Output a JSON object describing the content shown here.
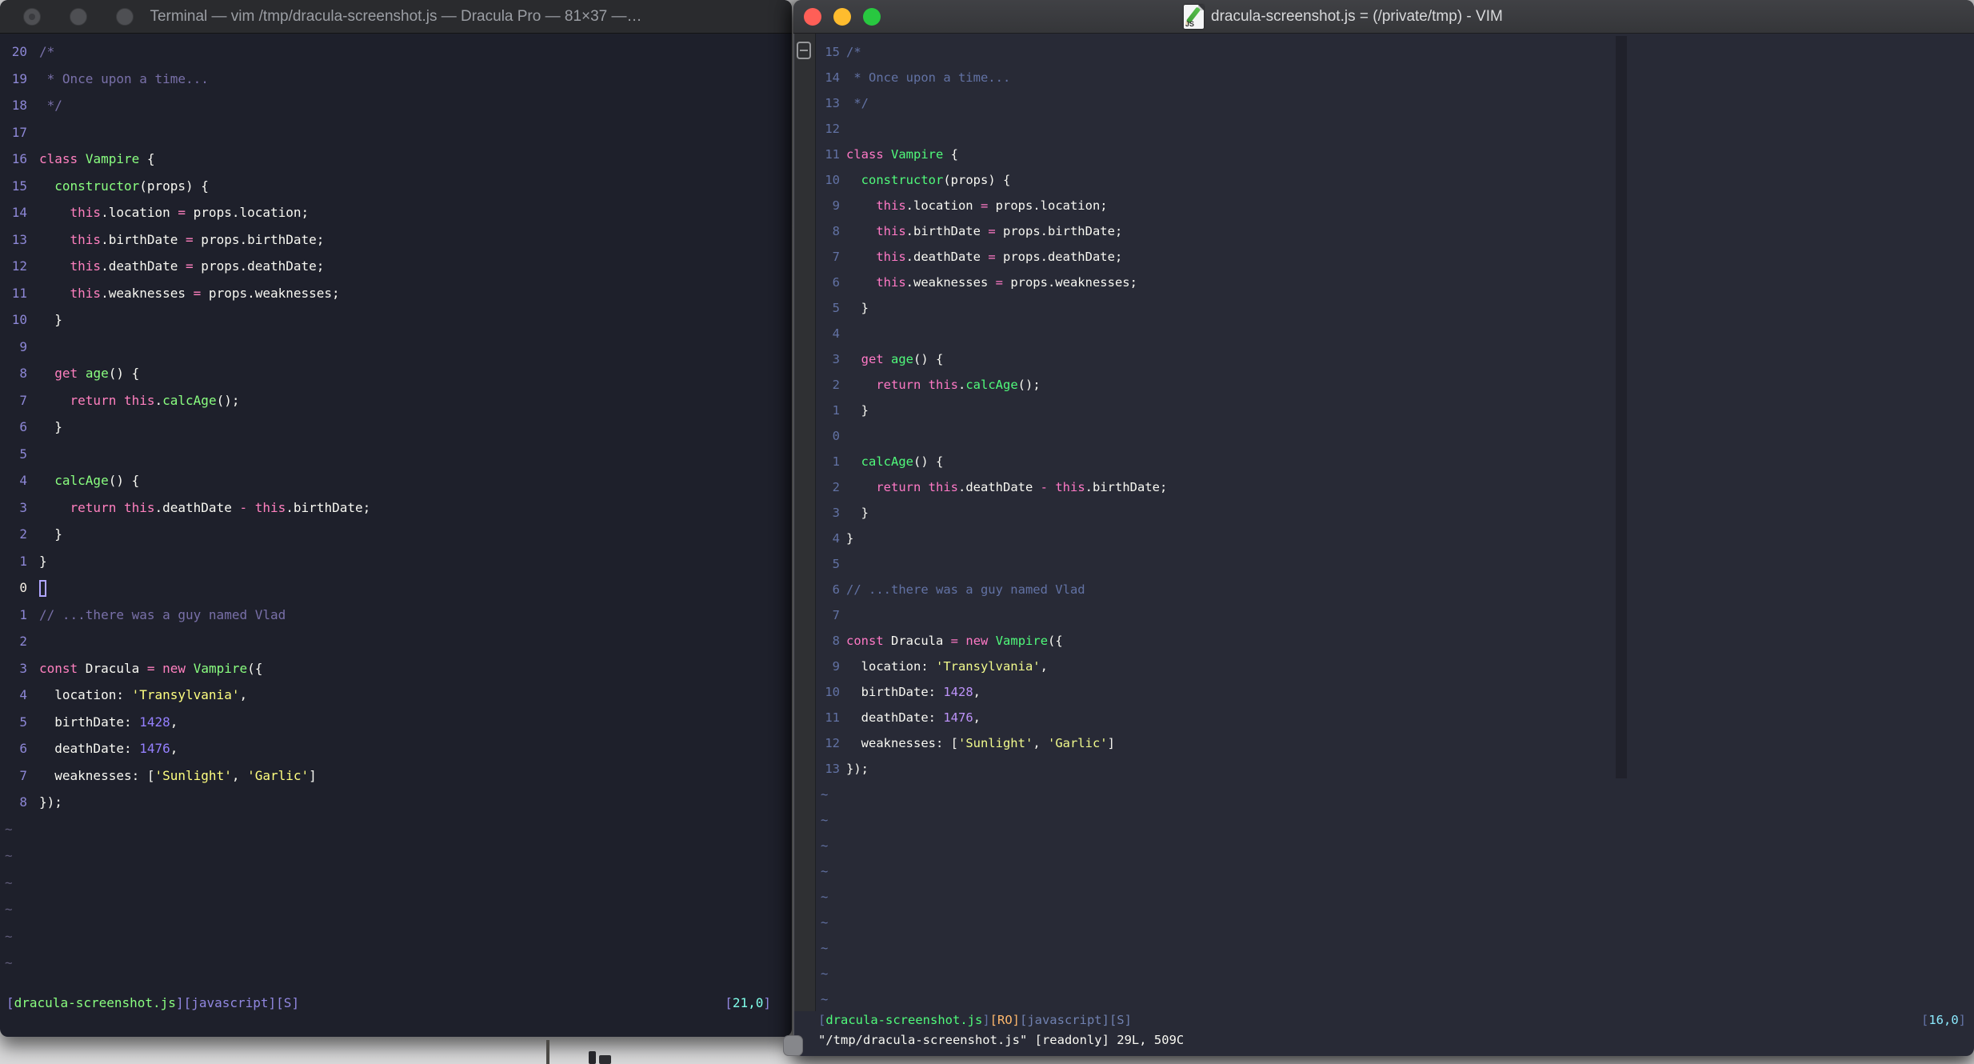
{
  "left_window": {
    "title": "Terminal — vim /tmp/dracula-screenshot.js — Dracula Pro — 81×37 —…",
    "traffic_lights": {
      "close": "#4E4F53",
      "minimize": "#4E4F53",
      "zoom": "#4E4F53"
    },
    "palette": {
      "c": "#7970A9",
      "p": "#FF80BF",
      "g": "#8AFF80",
      "w": "#F8F8F2",
      "y": "#FFFF80",
      "n": "#9580FF",
      "ln": "#8D87D6",
      "ln_cur": "#F5EFE4",
      "tilde": "#5E5A78",
      "bg": "#1E202B"
    },
    "lines": [
      {
        "num": "20",
        "segs": [
          [
            "c",
            "/*"
          ]
        ]
      },
      {
        "num": "19",
        "segs": [
          [
            "c",
            " * Once upon a time..."
          ]
        ]
      },
      {
        "num": "18",
        "segs": [
          [
            "c",
            " */"
          ]
        ]
      },
      {
        "num": "17",
        "segs": []
      },
      {
        "num": "16",
        "segs": [
          [
            "p",
            "class"
          ],
          [
            "w",
            " "
          ],
          [
            "g",
            "Vampire"
          ],
          [
            "w",
            " {"
          ]
        ]
      },
      {
        "num": "15",
        "segs": [
          [
            "w",
            "  "
          ],
          [
            "g",
            "constructor"
          ],
          [
            "w",
            "(props) {"
          ]
        ]
      },
      {
        "num": "14",
        "segs": [
          [
            "w",
            "    "
          ],
          [
            "p",
            "this"
          ],
          [
            "w",
            ".location "
          ],
          [
            "p",
            "="
          ],
          [
            "w",
            " props.location;"
          ]
        ]
      },
      {
        "num": "13",
        "segs": [
          [
            "w",
            "    "
          ],
          [
            "p",
            "this"
          ],
          [
            "w",
            ".birthDate "
          ],
          [
            "p",
            "="
          ],
          [
            "w",
            " props.birthDate;"
          ]
        ]
      },
      {
        "num": "12",
        "segs": [
          [
            "w",
            "    "
          ],
          [
            "p",
            "this"
          ],
          [
            "w",
            ".deathDate "
          ],
          [
            "p",
            "="
          ],
          [
            "w",
            " props.deathDate;"
          ]
        ]
      },
      {
        "num": "11",
        "segs": [
          [
            "w",
            "    "
          ],
          [
            "p",
            "this"
          ],
          [
            "w",
            ".weaknesses "
          ],
          [
            "p",
            "="
          ],
          [
            "w",
            " props.weaknesses;"
          ]
        ]
      },
      {
        "num": "10",
        "segs": [
          [
            "w",
            "  }"
          ]
        ]
      },
      {
        "num": "9",
        "segs": []
      },
      {
        "num": "8",
        "segs": [
          [
            "w",
            "  "
          ],
          [
            "p",
            "get"
          ],
          [
            "w",
            " "
          ],
          [
            "g",
            "age"
          ],
          [
            "w",
            "() {"
          ]
        ]
      },
      {
        "num": "7",
        "segs": [
          [
            "w",
            "    "
          ],
          [
            "p",
            "return"
          ],
          [
            "w",
            " "
          ],
          [
            "p",
            "this"
          ],
          [
            "w",
            "."
          ],
          [
            "g",
            "calcAge"
          ],
          [
            "w",
            "();"
          ]
        ]
      },
      {
        "num": "6",
        "segs": [
          [
            "w",
            "  }"
          ]
        ]
      },
      {
        "num": "5",
        "segs": []
      },
      {
        "num": "4",
        "segs": [
          [
            "w",
            "  "
          ],
          [
            "g",
            "calcAge"
          ],
          [
            "w",
            "() {"
          ]
        ]
      },
      {
        "num": "3",
        "segs": [
          [
            "w",
            "    "
          ],
          [
            "p",
            "return"
          ],
          [
            "w",
            " "
          ],
          [
            "p",
            "this"
          ],
          [
            "w",
            ".deathDate "
          ],
          [
            "p",
            "-"
          ],
          [
            "w",
            " "
          ],
          [
            "p",
            "this"
          ],
          [
            "w",
            ".birthDate;"
          ]
        ]
      },
      {
        "num": "2",
        "segs": [
          [
            "w",
            "  }"
          ]
        ]
      },
      {
        "num": "1",
        "segs": [
          [
            "w",
            "}"
          ]
        ]
      },
      {
        "num": "0",
        "cursor": true,
        "segs": []
      },
      {
        "num": "1",
        "segs": [
          [
            "c",
            "// ...there was a guy named Vlad"
          ]
        ]
      },
      {
        "num": "2",
        "segs": []
      },
      {
        "num": "3",
        "segs": [
          [
            "p",
            "const"
          ],
          [
            "w",
            " Dracula "
          ],
          [
            "p",
            "="
          ],
          [
            "w",
            " "
          ],
          [
            "p",
            "new"
          ],
          [
            "w",
            " "
          ],
          [
            "g",
            "Vampire"
          ],
          [
            "w",
            "({"
          ]
        ]
      },
      {
        "num": "4",
        "segs": [
          [
            "w",
            "  location: "
          ],
          [
            "y",
            "'Transylvania'"
          ],
          [
            "w",
            ","
          ]
        ]
      },
      {
        "num": "5",
        "segs": [
          [
            "w",
            "  birthDate: "
          ],
          [
            "n",
            "1428"
          ],
          [
            "w",
            ","
          ]
        ]
      },
      {
        "num": "6",
        "segs": [
          [
            "w",
            "  deathDate: "
          ],
          [
            "n",
            "1476"
          ],
          [
            "w",
            ","
          ]
        ]
      },
      {
        "num": "7",
        "segs": [
          [
            "w",
            "  weaknesses: ["
          ],
          [
            "y",
            "'Sunlight'"
          ],
          [
            "w",
            ", "
          ],
          [
            "y",
            "'Garlic'"
          ],
          [
            "w",
            "]"
          ]
        ]
      },
      {
        "num": "8",
        "segs": [
          [
            "w",
            "});"
          ]
        ]
      }
    ],
    "tilde_count": 6,
    "status_segments": [
      [
        "[",
        "#9187E0"
      ],
      [
        "dracula-screenshot.js",
        "#8AFF80"
      ],
      [
        "]",
        "#9187E0"
      ],
      [
        "[javascript]",
        "#9187E0"
      ],
      [
        "[S]",
        "#9187E0"
      ]
    ],
    "ruler_segments": [
      [
        "[",
        "#9187E0"
      ],
      [
        "21,0",
        "#80FFEA"
      ],
      [
        "]",
        "#9187E0"
      ]
    ]
  },
  "right_window": {
    "title": "dracula-screenshot.js = (/private/tmp) - VIM",
    "doc_icon_label": "JS",
    "traffic_lights": {
      "close": "#FF5F57",
      "minimize": "#FEBC2E",
      "zoom": "#28C840"
    },
    "palette": {
      "c": "#6272A4",
      "p": "#FF79C6",
      "g": "#50FA7B",
      "w": "#F8F8F2",
      "y": "#F1FA8C",
      "n": "#BD93F9",
      "ln": "#6272A4",
      "ln_cur": "#6272A4",
      "tilde": "#6272A4",
      "bg": "#282A36"
    },
    "lines": [
      {
        "num": "15",
        "segs": [
          [
            "c",
            "/*"
          ]
        ]
      },
      {
        "num": "14",
        "segs": [
          [
            "c",
            " * Once upon a time..."
          ]
        ]
      },
      {
        "num": "13",
        "segs": [
          [
            "c",
            " */"
          ]
        ]
      },
      {
        "num": "12",
        "segs": []
      },
      {
        "num": "11",
        "segs": [
          [
            "p",
            "class"
          ],
          [
            "w",
            " "
          ],
          [
            "g",
            "Vampire"
          ],
          [
            "w",
            " {"
          ]
        ]
      },
      {
        "num": "10",
        "segs": [
          [
            "w",
            "  "
          ],
          [
            "g",
            "constructor"
          ],
          [
            "w",
            "(props) {"
          ]
        ]
      },
      {
        "num": "9",
        "segs": [
          [
            "w",
            "    "
          ],
          [
            "p",
            "this"
          ],
          [
            "w",
            ".location "
          ],
          [
            "p",
            "="
          ],
          [
            "w",
            " props.location;"
          ]
        ]
      },
      {
        "num": "8",
        "segs": [
          [
            "w",
            "    "
          ],
          [
            "p",
            "this"
          ],
          [
            "w",
            ".birthDate "
          ],
          [
            "p",
            "="
          ],
          [
            "w",
            " props.birthDate;"
          ]
        ]
      },
      {
        "num": "7",
        "segs": [
          [
            "w",
            "    "
          ],
          [
            "p",
            "this"
          ],
          [
            "w",
            ".deathDate "
          ],
          [
            "p",
            "="
          ],
          [
            "w",
            " props.deathDate;"
          ]
        ]
      },
      {
        "num": "6",
        "segs": [
          [
            "w",
            "    "
          ],
          [
            "p",
            "this"
          ],
          [
            "w",
            ".weaknesses "
          ],
          [
            "p",
            "="
          ],
          [
            "w",
            " props.weaknesses;"
          ]
        ]
      },
      {
        "num": "5",
        "segs": [
          [
            "w",
            "  }"
          ]
        ]
      },
      {
        "num": "4",
        "segs": []
      },
      {
        "num": "3",
        "segs": [
          [
            "w",
            "  "
          ],
          [
            "p",
            "get"
          ],
          [
            "w",
            " "
          ],
          [
            "g",
            "age"
          ],
          [
            "w",
            "() {"
          ]
        ]
      },
      {
        "num": "2",
        "segs": [
          [
            "w",
            "    "
          ],
          [
            "p",
            "return"
          ],
          [
            "w",
            " "
          ],
          [
            "p",
            "this"
          ],
          [
            "w",
            "."
          ],
          [
            "g",
            "calcAge"
          ],
          [
            "w",
            "();"
          ]
        ]
      },
      {
        "num": "1",
        "segs": [
          [
            "w",
            "  }"
          ]
        ]
      },
      {
        "num": "0",
        "segs": []
      },
      {
        "num": "1",
        "segs": [
          [
            "w",
            "  "
          ],
          [
            "g",
            "calcAge"
          ],
          [
            "w",
            "() {"
          ]
        ]
      },
      {
        "num": "2",
        "segs": [
          [
            "w",
            "    "
          ],
          [
            "p",
            "return"
          ],
          [
            "w",
            " "
          ],
          [
            "p",
            "this"
          ],
          [
            "w",
            ".deathDate "
          ],
          [
            "p",
            "-"
          ],
          [
            "w",
            " "
          ],
          [
            "p",
            "this"
          ],
          [
            "w",
            ".birthDate;"
          ]
        ]
      },
      {
        "num": "3",
        "segs": [
          [
            "w",
            "  }"
          ]
        ]
      },
      {
        "num": "4",
        "segs": [
          [
            "w",
            "}"
          ]
        ]
      },
      {
        "num": "5",
        "segs": []
      },
      {
        "num": "6",
        "segs": [
          [
            "c",
            "// ...there was a guy named Vlad"
          ]
        ]
      },
      {
        "num": "7",
        "segs": []
      },
      {
        "num": "8",
        "segs": [
          [
            "p",
            "const"
          ],
          [
            "w",
            " Dracula "
          ],
          [
            "p",
            "="
          ],
          [
            "w",
            " "
          ],
          [
            "p",
            "new"
          ],
          [
            "w",
            " "
          ],
          [
            "g",
            "Vampire"
          ],
          [
            "w",
            "({"
          ]
        ]
      },
      {
        "num": "9",
        "segs": [
          [
            "w",
            "  location: "
          ],
          [
            "y",
            "'Transylvania'"
          ],
          [
            "w",
            ","
          ]
        ]
      },
      {
        "num": "10",
        "segs": [
          [
            "w",
            "  birthDate: "
          ],
          [
            "n",
            "1428"
          ],
          [
            "w",
            ","
          ]
        ]
      },
      {
        "num": "11",
        "segs": [
          [
            "w",
            "  deathDate: "
          ],
          [
            "n",
            "1476"
          ],
          [
            "w",
            ","
          ]
        ]
      },
      {
        "num": "12",
        "segs": [
          [
            "w",
            "  weaknesses: ["
          ],
          [
            "y",
            "'Sunlight'"
          ],
          [
            "w",
            ", "
          ],
          [
            "y",
            "'Garlic'"
          ],
          [
            "w",
            "]"
          ]
        ]
      },
      {
        "num": "13",
        "segs": [
          [
            "w",
            "});"
          ]
        ]
      }
    ],
    "tilde_count": 9,
    "status_segments": [
      [
        "[",
        "#6272A4"
      ],
      [
        "dracula-screenshot.js",
        "#50FA7B"
      ],
      [
        "]",
        "#6272A4"
      ],
      [
        "[RO]",
        "#FFB86C"
      ],
      [
        "[javascript]",
        "#7081B0"
      ],
      [
        "[S]",
        "#7081B0"
      ]
    ],
    "ruler_segments": [
      [
        "[",
        "#6272A4"
      ],
      [
        "16,0",
        "#8BE9FD"
      ],
      [
        "]",
        "#6272A4"
      ]
    ],
    "cmdline": "\"/tmp/dracula-screenshot.js\" [readonly] 29L, 509C"
  }
}
